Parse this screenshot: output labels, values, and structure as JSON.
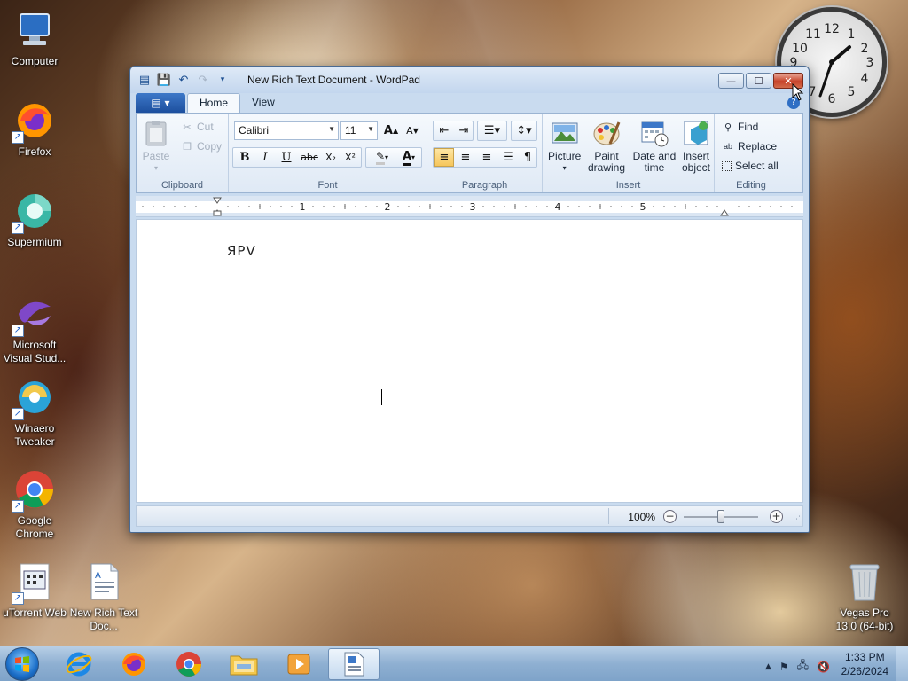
{
  "desktop": {
    "icons": [
      {
        "label": "Computer",
        "icon": "computer-icon"
      },
      {
        "label": "Firefox",
        "icon": "firefox-icon"
      },
      {
        "label": "Supermium",
        "icon": "supermium-icon"
      },
      {
        "label": "Microsoft Visual Stud...",
        "icon": "visual-studio-icon"
      },
      {
        "label": "Winaero Tweaker",
        "icon": "winaero-icon"
      },
      {
        "label": "Google Chrome",
        "icon": "chrome-icon"
      },
      {
        "label": "uTorrent Web",
        "icon": "utorrent-icon"
      },
      {
        "label": "New Rich Text Doc...",
        "icon": "rtf-document-icon"
      },
      {
        "label": "Vegas Pro 13.0 (64-bit)",
        "icon": "recycle-bin-icon"
      }
    ]
  },
  "clock": {
    "numbers": [
      "12",
      "1",
      "2",
      "3",
      "4",
      "5",
      "6",
      "7",
      "8",
      "9",
      "10",
      "11"
    ],
    "time_shown": "1:33"
  },
  "window": {
    "title": "New Rich Text Document - WordPad",
    "caption": {
      "minimize": "—",
      "maximize": "☐",
      "close": "✕"
    }
  },
  "ribbon": {
    "tabs": [
      "Home",
      "View"
    ],
    "active_tab": "Home",
    "clipboard": {
      "paste": "Paste",
      "cut": "Cut",
      "copy": "Copy",
      "group": "Clipboard"
    },
    "font": {
      "family": "Calibri",
      "size": "11",
      "group": "Font",
      "bold": "B",
      "italic": "I",
      "underline": "U",
      "strike": "abc",
      "subscript": "X₂",
      "superscript": "X²",
      "grow": "A",
      "shrink": "A"
    },
    "paragraph": {
      "group": "Paragraph"
    },
    "insert": {
      "picture": "Picture",
      "paint_drawing": "Paint drawing",
      "date_time": "Date and time",
      "insert_object": "Insert object",
      "group": "Insert"
    },
    "editing": {
      "find": "Find",
      "replace": "Replace",
      "select_all": "Select all",
      "group": "Editing"
    }
  },
  "ruler": {
    "numbers": [
      "1",
      "2",
      "3",
      "4",
      "5"
    ]
  },
  "document": {
    "text": "ЯPV"
  },
  "status": {
    "zoom": "100%",
    "zoom_fraction": 0.5,
    "zoom_out": "−",
    "zoom_in": "+"
  },
  "taskbar": {
    "apps": [
      "internet-explorer-icon",
      "firefox-icon",
      "chrome-icon",
      "file-explorer-icon",
      "media-player-icon",
      "wordpad-icon"
    ],
    "time": "1:33 PM",
    "date": "2/26/2024"
  },
  "colors": {
    "title_bar": "#c3d6ee",
    "close_button": "#c7432a",
    "accent": "#1d4f9e"
  }
}
